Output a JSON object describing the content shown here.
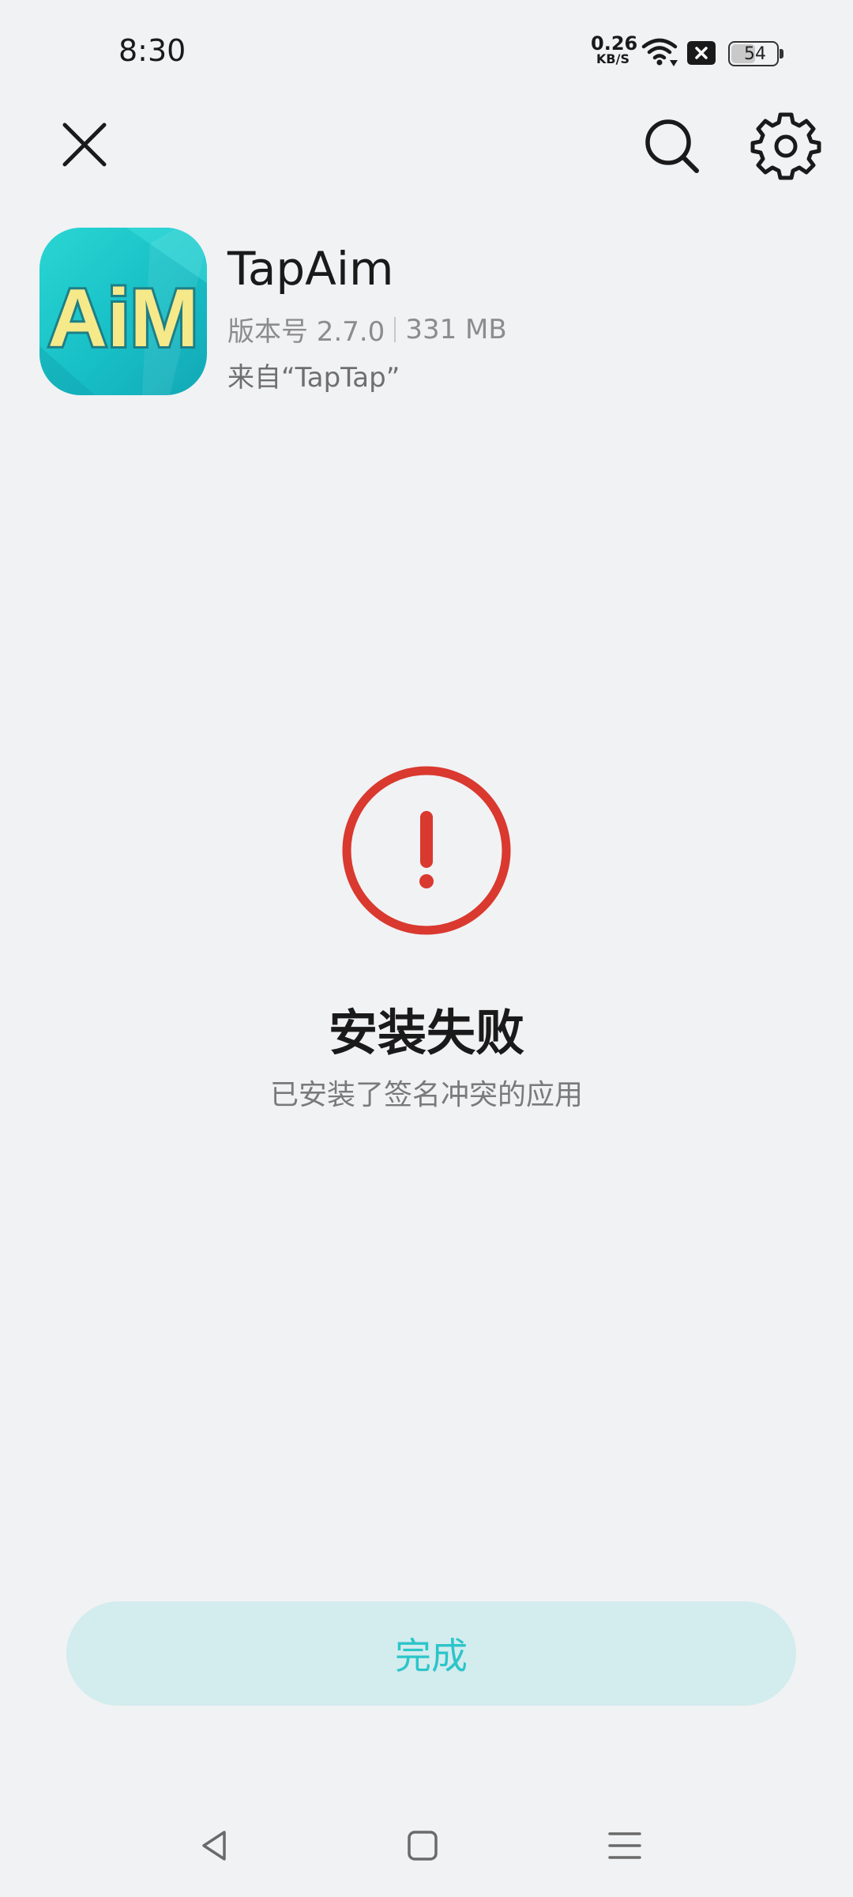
{
  "status_bar": {
    "time": "8:30",
    "net_speed_value": "0.26",
    "net_speed_unit": "KB/S",
    "battery_level": "54",
    "battery_fraction": 0.54
  },
  "toolbar": {
    "close_icon": "close-icon",
    "search_icon": "search-icon",
    "settings_icon": "gear-icon"
  },
  "app": {
    "name": "TapAim",
    "version": "版本号 2.7.0",
    "size": "331 MB",
    "source": "来自“TapTap”",
    "icon_text": "AiM"
  },
  "result": {
    "title": "安装失败",
    "message": "已安装了签名冲突的应用",
    "status_color": "#d9392f"
  },
  "actions": {
    "done_label": "完成",
    "accent_color": "#2cc5c9"
  },
  "navigation": {
    "back_icon": "back-triangle-icon",
    "home_icon": "home-square-icon",
    "menu_icon": "menu-lines-icon"
  }
}
